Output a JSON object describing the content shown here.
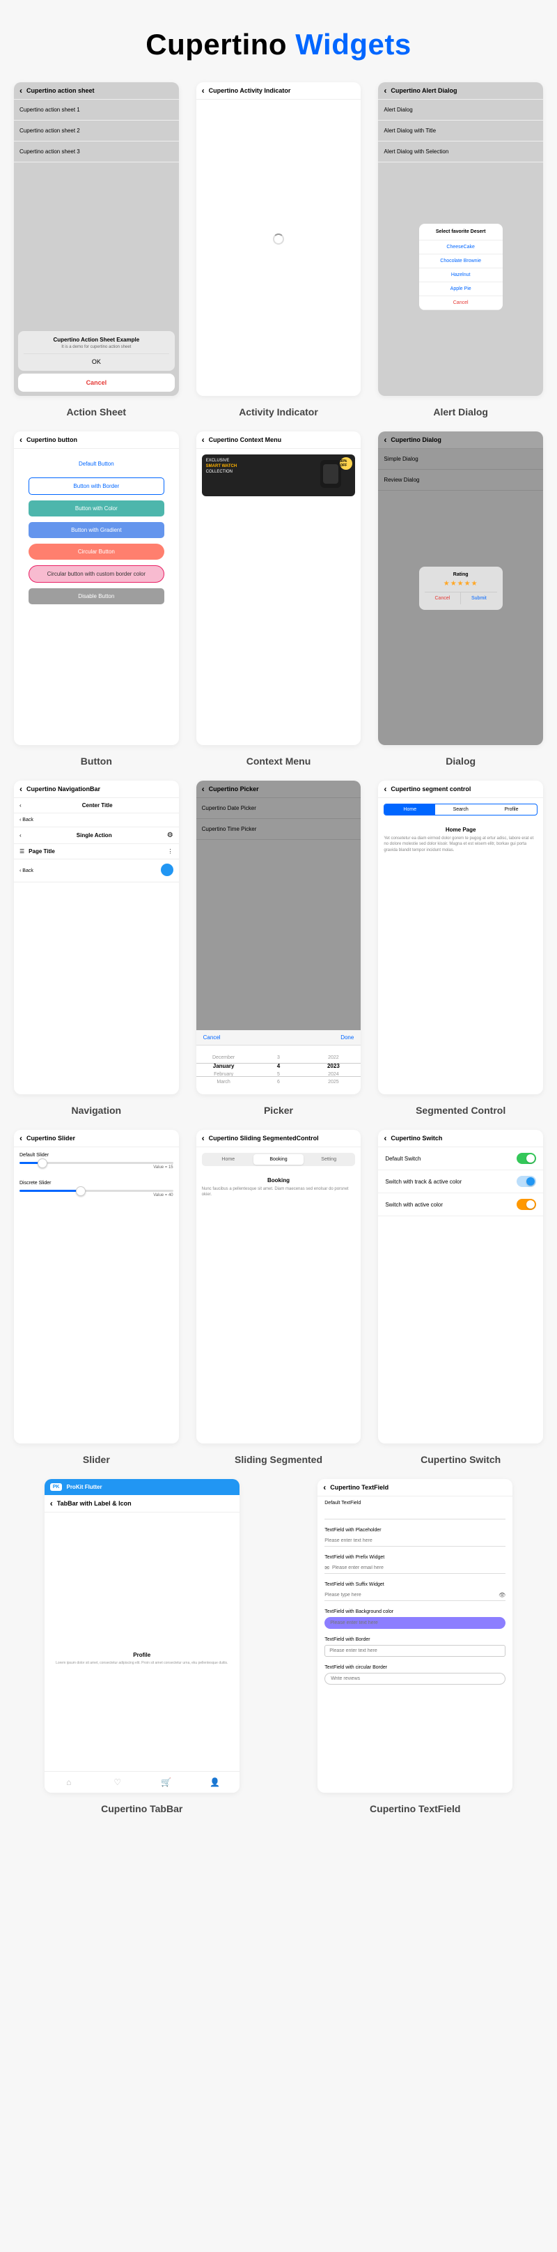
{
  "title": {
    "part1": "Cupertino",
    "part2": "Widgets"
  },
  "action_sheet": {
    "topbar": "Cupertino action sheet",
    "items": [
      "Cupertino action sheet 1",
      "Cupertino action sheet 2",
      "Cupertino action sheet 3"
    ],
    "box_title": "Cupertino Action Sheet Example",
    "box_sub": "It is a demo for cupertino action sheet",
    "ok": "OK",
    "cancel": "Cancel",
    "label": "Action Sheet"
  },
  "activity": {
    "topbar": "Cupertino Activity Indicator",
    "label": "Activity Indicator"
  },
  "alert_dialog": {
    "topbar": "Cupertino Alert Dialog",
    "rows": [
      "Alert Dialog",
      "Alert Dialog with Title",
      "Alert Dialog with Selection"
    ],
    "sheet_title": "Select favorite Desert",
    "options": [
      "CheeseCake",
      "Chocolate Brownie",
      "Hazelnut",
      "Apple Pie"
    ],
    "cancel": "Cancel",
    "label": "Alert Dialog"
  },
  "button": {
    "topbar": "Cupertino button",
    "btns": {
      "default": "Default Button",
      "border": "Button with Border",
      "color": "Button with Color",
      "gradient": "Button with Gradient",
      "circular": "Circular Button",
      "circular_border": "Circular button with custom border color",
      "disable": "Disable Button"
    },
    "label": "Button"
  },
  "context_menu": {
    "topbar": "Cupertino Context Menu",
    "banner": {
      "line1": "EXCLUSIVE",
      "line2": "SMART WATCH",
      "line3": "COLLECTION",
      "badge": "30% OFF"
    },
    "label": "Context Menu"
  },
  "dialog": {
    "topbar": "Cupertino Dialog",
    "rows": [
      "Simple Dialog",
      "Review Dialog"
    ],
    "popup": {
      "title": "Rating",
      "stars": "★★★★★",
      "cancel": "Cancel",
      "submit": "Submit"
    },
    "label": "Dialog"
  },
  "navigation": {
    "topbar": "Cupertino NavigationBar",
    "rows": {
      "center_title": "Center Title",
      "back": "Back",
      "single_action": "Single Action",
      "page_title": "Page Title"
    },
    "label": "Navigation"
  },
  "picker": {
    "topbar": "Cupertino Picker",
    "rows": [
      "Cupertino Date Picker",
      "Cupertino Time Picker"
    ],
    "cancel": "Cancel",
    "done": "Done",
    "months": {
      "prev": "December",
      "sel": "January",
      "next": "February",
      "next2": "March"
    },
    "days": {
      "prev": "3",
      "sel": "4",
      "next": "5",
      "next2": "6"
    },
    "years": {
      "prev": "2022",
      "sel": "2023",
      "next": "2024",
      "next2": "2025"
    },
    "label": "Picker"
  },
  "segmented": {
    "topbar": "Cupertino segment control",
    "tabs": [
      "Home",
      "Search",
      "Profile"
    ],
    "body_title": "Home Page",
    "body_text": "Yet consetetur ea diam eirmod dolor gorem te pugog at ertur adisc, labore erat et no dolore molestie sed dolor kisoir. Magna et est wisem elitr, borkav gui porta gravida blandit tempor incidunt molas.",
    "label": "Segmented Control"
  },
  "slider": {
    "topbar": "Cupertino Slider",
    "default_label": "Default Slider",
    "default_value": "Value = 15",
    "discrete_label": "Discrete Slider",
    "discrete_value": "Value = 40",
    "label": "Slider"
  },
  "sliding_seg": {
    "topbar": "Cupertino Sliding SegmentedControl",
    "tabs": [
      "Home",
      "Booking",
      "Setting"
    ],
    "body_title": "Booking",
    "body_text": "Nunc faucibus a pellentesque sit amet. Diam maecenas sed enolsar do porsnet okier.",
    "label": "Sliding Segmented"
  },
  "cswitch": {
    "topbar": "Cupertino Switch",
    "rows": [
      "Default Switch",
      "Switch with track & active color",
      "Switch with active color"
    ],
    "label": "Cupertino Switch"
  },
  "tabbar": {
    "logo": "PK",
    "brand": "ProKit Flutter",
    "title": "TabBar with Label & Icon",
    "profile_h": "Profile",
    "profile_p": "Lorem ipsum dolor sit amet, consectetur adipiscing elit. Proin sit amet consectetur urna, eku pellentesque duitis.",
    "label": "Cupertino TabBar"
  },
  "textfield": {
    "topbar": "Cupertino TextField",
    "default": "Default TextField",
    "placeholder_lbl": "TextField with Placeholder",
    "placeholder_ph": "Please enter text here",
    "prefix_lbl": "TextField with Prefix Widget",
    "prefix_ph": "Please enter email here",
    "suffix_lbl": "TextField with Suffix Widget",
    "suffix_ph": "Please type here",
    "bg_lbl": "TextField with Background color",
    "bg_ph": "Please enter text here",
    "border_lbl": "TextField with Border",
    "border_ph": "Please enter text here",
    "circular_lbl": "TextField with circular Border",
    "circular_ph": "Write reviews",
    "label": "Cupertino TextField"
  }
}
